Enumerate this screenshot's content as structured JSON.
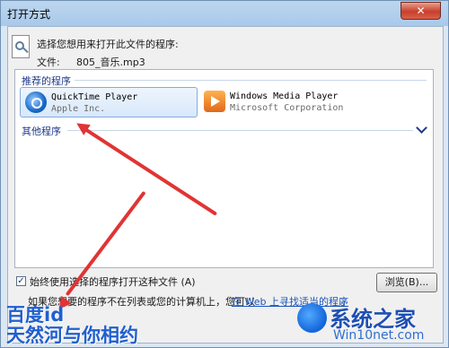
{
  "window": {
    "title": "打开方式",
    "close_label": "✕"
  },
  "header": {
    "prompt": "选择您想用来打开此文件的程序:",
    "file_label": "文件:",
    "file_name": "805_音乐.mp3"
  },
  "recommended": {
    "label": "推荐的程序",
    "programs": [
      {
        "name": "QuickTime Player",
        "vendor": "Apple Inc.",
        "icon": "quicktime-icon",
        "selected": true
      },
      {
        "name": "Windows Media Player",
        "vendor": "Microsoft Corporation",
        "icon": "windows-media-player-icon",
        "selected": false
      }
    ]
  },
  "other": {
    "label": "其他程序"
  },
  "options": {
    "always_use_label": "始终使用选择的程序打开这种文件 (A)",
    "always_use_checked": true,
    "browse_label": "浏览(B)...",
    "not_listed_text": "如果您想要的程序不在列表或您的计算机上，您可以",
    "web_link": "在 Web 上寻找适当的程序",
    "not_listed_tail": "。"
  },
  "watermarks": {
    "left_line1": "百度id",
    "left_line2": "天然河与你相约",
    "brand": "系统之家",
    "url": "Win10net.com"
  },
  "colors": {
    "arrow": "#e13434",
    "link": "#1a54b8",
    "group_label": "#1e3a8a"
  }
}
